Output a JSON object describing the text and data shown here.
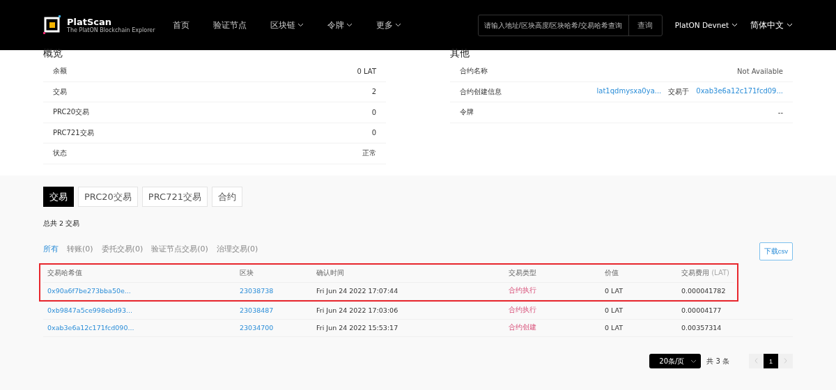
{
  "header": {
    "brand": "PlatScan",
    "tagline": "The PlatON Blockchain Explorer",
    "nav": [
      {
        "label": "首页",
        "dropdown": false
      },
      {
        "label": "验证节点",
        "dropdown": false
      },
      {
        "label": "区块链",
        "dropdown": true
      },
      {
        "label": "令牌",
        "dropdown": true
      },
      {
        "label": "更多",
        "dropdown": true
      }
    ],
    "search": {
      "placeholder": "请输入地址/区块高度/区块哈希/交易哈希查询",
      "button": "查询"
    },
    "network": "PlatON Devnet",
    "language": "简体中文"
  },
  "overview": {
    "title": "概览",
    "rows": [
      {
        "label": "余额",
        "value": "0 LAT"
      },
      {
        "label": "交易",
        "value": "2"
      },
      {
        "label": "PRC20交易",
        "value": "0"
      },
      {
        "label": "PRC721交易",
        "value": "0"
      },
      {
        "label": "状态",
        "value": "正常"
      }
    ]
  },
  "other": {
    "title": "其他",
    "contract_name": {
      "label": "合约名称",
      "value": "Not Available"
    },
    "creation": {
      "label": "合约创建信息",
      "creator": "lat1qdmysxa0ya...",
      "middle": "交易于",
      "tx": "0xab3e6a12c171fcd09..."
    },
    "token": {
      "label": "令牌",
      "value": "--"
    }
  },
  "tabs": [
    {
      "label": "交易",
      "selected": true
    },
    {
      "label": "PRC20交易",
      "selected": false
    },
    {
      "label": "PRC721交易",
      "selected": false
    },
    {
      "label": "合约",
      "selected": false
    }
  ],
  "total": "总共 2 交易",
  "filters": [
    {
      "label": "所有",
      "selected": true
    },
    {
      "label": "转账(0)",
      "selected": false
    },
    {
      "label": "委托交易(0)",
      "selected": false
    },
    {
      "label": "验证节点交易(0)",
      "selected": false
    },
    {
      "label": "治理交易(0)",
      "selected": false
    }
  ],
  "download": "下载csv",
  "table": {
    "columns": [
      "交易哈希值",
      "区块",
      "确认时间",
      "交易类型",
      "价值",
      "交易费用"
    ],
    "fee_unit": "(LAT)",
    "rows": [
      {
        "hash": "0x90a6f7be273bba50e...",
        "block": "23038738",
        "time": "Fri Jun 24 2022 17:07:44",
        "type": "合约执行",
        "value": "0 LAT",
        "fee": "0.000041782",
        "highlighted": true
      },
      {
        "hash": "0xb9847a5ce998ebd93...",
        "block": "23038487",
        "time": "Fri Jun 24 2022 17:03:06",
        "type": "合约执行",
        "value": "0 LAT",
        "fee": "0.00004177",
        "highlighted": false
      },
      {
        "hash": "0xab3e6a12c171fcd090...",
        "block": "23034700",
        "time": "Fri Jun 24 2022 15:53:17",
        "type": "合约创建",
        "value": "0 LAT",
        "fee": "0.00357314",
        "highlighted": false
      }
    ]
  },
  "pagination": {
    "page_size": "20条/页",
    "total": "共 3 条",
    "pages": [
      {
        "label": "1",
        "selected": true
      }
    ]
  }
}
